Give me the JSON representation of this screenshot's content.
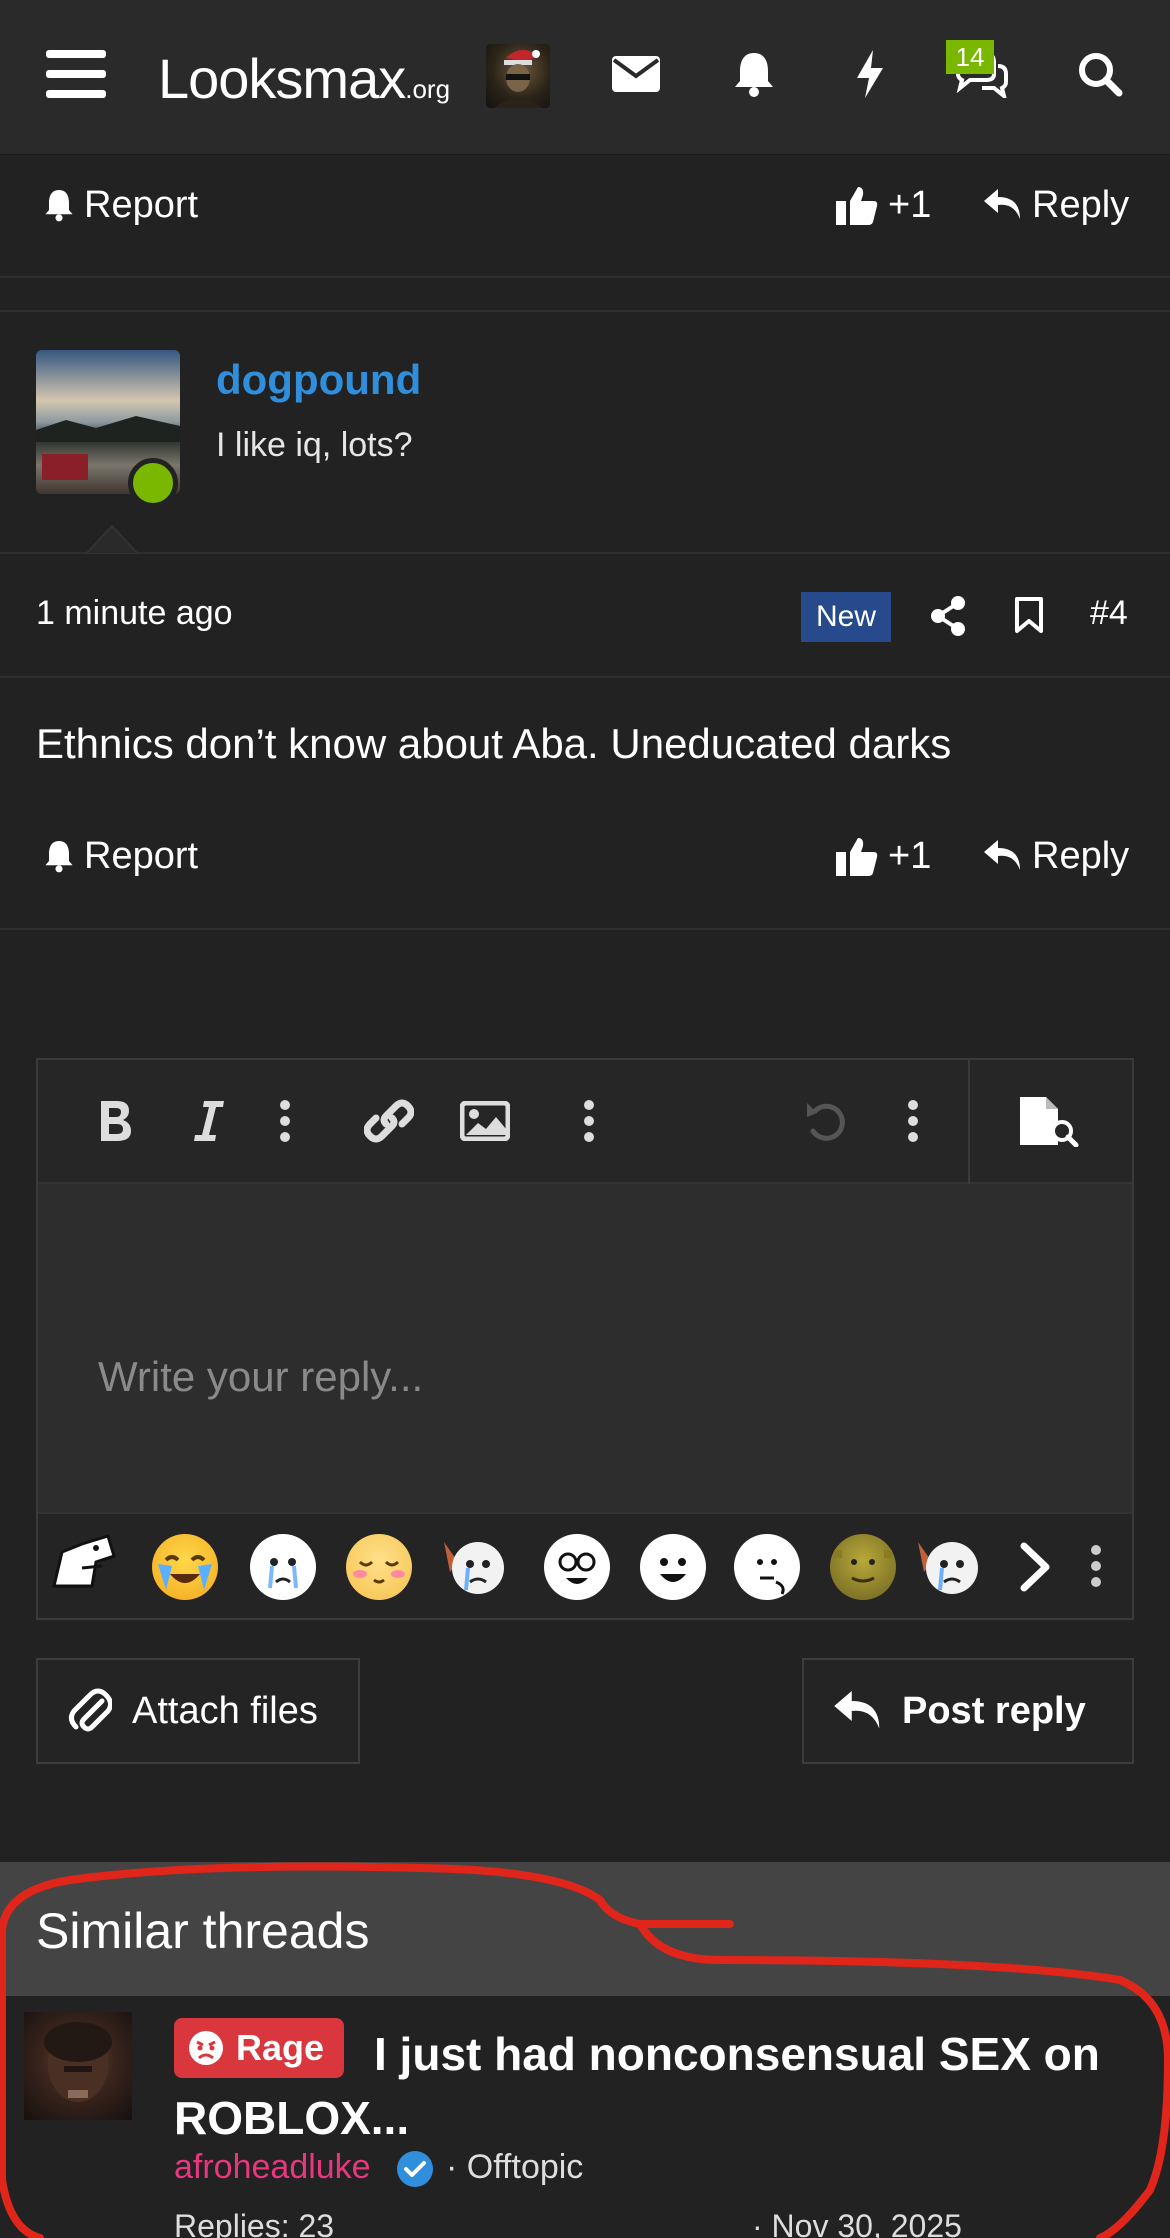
{
  "header": {
    "logo_main": "Looksmax",
    "logo_suffix": ".org",
    "conversations_badge": "14"
  },
  "previous_post_actions": {
    "report_label": "Report",
    "like_count": "+1",
    "reply_label": "Reply"
  },
  "post": {
    "username": "dogpound",
    "user_title": "I like iq, lots?",
    "time": "1 minute ago",
    "new_badge": "New",
    "post_number": "#4",
    "body": "Ethnics don’t know about Aba. Uneducated darks",
    "actions": {
      "report_label": "Report",
      "like_count": "+1",
      "reply_label": "Reply"
    }
  },
  "editor": {
    "placeholder": "Write your reply...",
    "attach_label": "Attach files",
    "post_reply_label": "Post reply"
  },
  "similar_threads": {
    "title": "Similar threads",
    "items": [
      {
        "prefix": "Rage",
        "title": "I just had nonconsensual SEX on ROBLOX...",
        "author": "afroheadluke",
        "forum": "· Offtopic",
        "replies": "Replies: 23",
        "date": "· Nov 30, 2025"
      }
    ]
  },
  "colors": {
    "background": "#222222",
    "header": "#2a2a2a",
    "username": "#2f8fdc",
    "online": "#7ab800",
    "new_badge": "#264a8c",
    "rage_prefix": "#d9363e",
    "author_link": "#e8377e",
    "annotation": "#e0251b"
  }
}
